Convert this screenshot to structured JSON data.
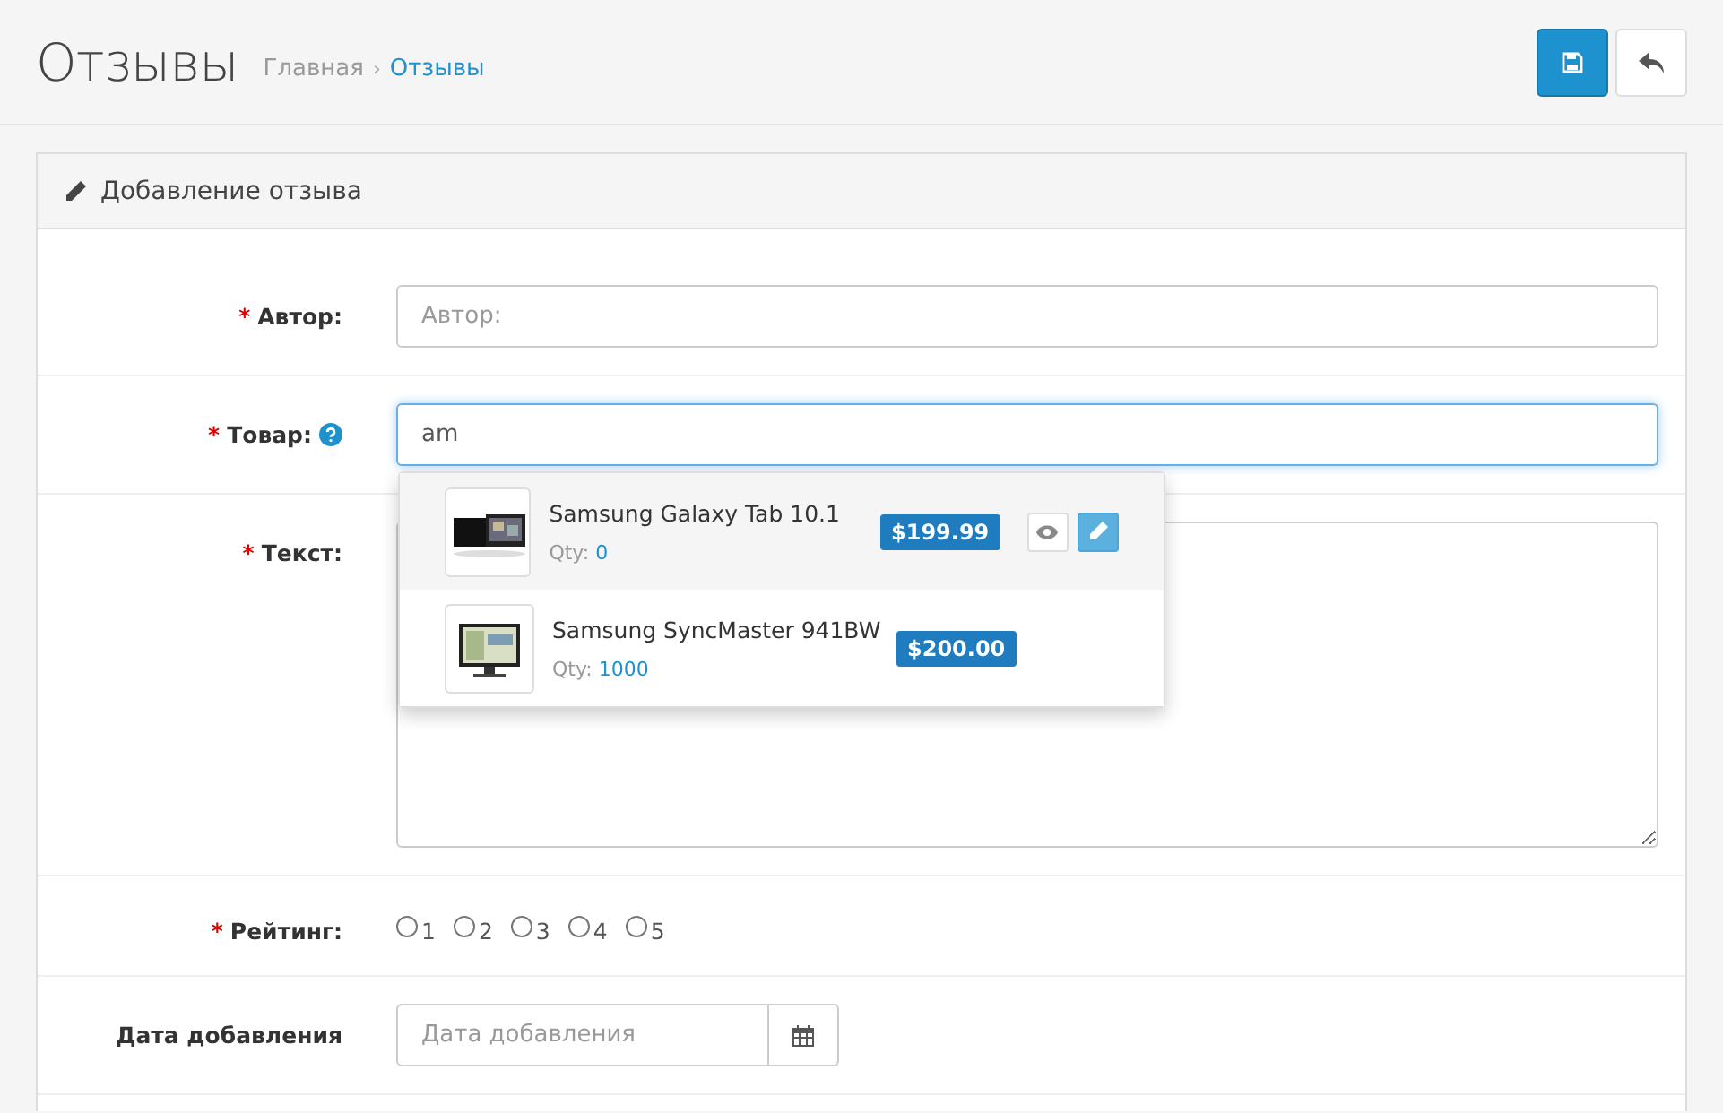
{
  "header": {
    "title": "Отзывы",
    "separator": "›",
    "breadcrumbs": [
      {
        "label": "Главная",
        "current": false
      },
      {
        "label": "Отзывы",
        "current": true
      }
    ]
  },
  "panel": {
    "title": "Добавление отзыва"
  },
  "fields": [
    {
      "kind": "text",
      "label": "Автор:",
      "required_mark": "*",
      "placeholder": "Автор:"
    },
    {
      "kind": "autocomplete",
      "label": "Товар:",
      "required_mark": "*",
      "help": true,
      "value": "am",
      "focused": true
    },
    {
      "kind": "textarea",
      "label": "Текст:",
      "required_mark": "*"
    },
    {
      "kind": "radio",
      "label": "Рейтинг:",
      "required_mark": "*",
      "options": [
        {
          "label": "1",
          "selected": false
        },
        {
          "label": "2",
          "selected": false
        },
        {
          "label": "3",
          "selected": false
        },
        {
          "label": "4",
          "selected": false
        },
        {
          "label": "5",
          "selected": false
        }
      ]
    },
    {
      "kind": "date",
      "label": "Дата добавления",
      "placeholder": "Дата добавления"
    }
  ],
  "suggestions": [
    {
      "name": "Samsung Galaxy Tab 10.1",
      "qty_label": "Qty:",
      "qty": "0",
      "price": "$199.99",
      "selected": true
    },
    {
      "name": "Samsung SyncMaster 941BW",
      "qty_label": "Qty:",
      "qty": "1000",
      "price": "$200.00",
      "selected": false
    }
  ]
}
